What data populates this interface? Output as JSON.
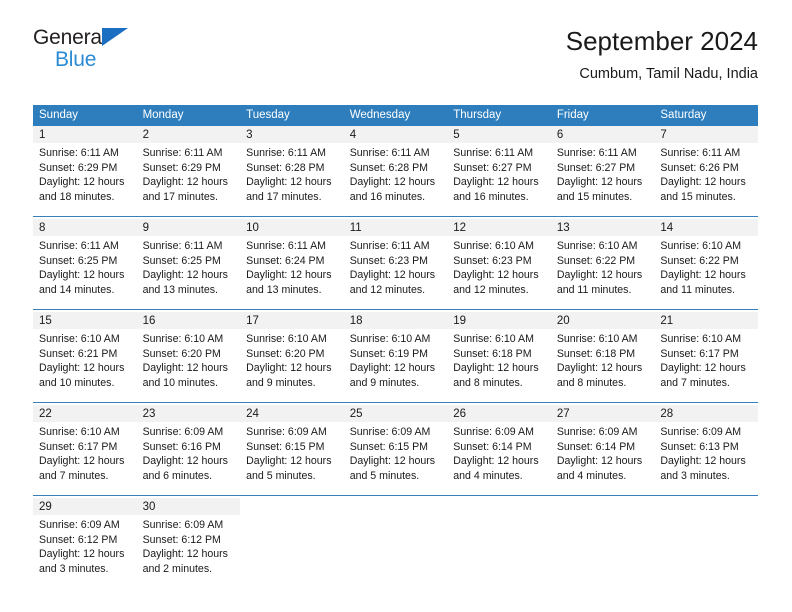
{
  "brand": {
    "line1": "General",
    "line2": "Blue",
    "accent_color": "#2b8bd4",
    "triangle_color": "#1b6ec2"
  },
  "header": {
    "title": "September 2024",
    "subtitle": "Cumbum, Tamil Nadu, India"
  },
  "calendar": {
    "header_bg": "#2e7ebd",
    "daynum_band_bg": "#f2f2f2",
    "week_separator_color": "#3b7fb8",
    "weekday_headers": [
      "Sunday",
      "Monday",
      "Tuesday",
      "Wednesday",
      "Thursday",
      "Friday",
      "Saturday"
    ],
    "weeks": [
      [
        {
          "day": "1",
          "sunrise": "Sunrise: 6:11 AM",
          "sunset": "Sunset: 6:29 PM",
          "daylight_line1": "Daylight: 12 hours",
          "daylight_line2": "and 18 minutes."
        },
        {
          "day": "2",
          "sunrise": "Sunrise: 6:11 AM",
          "sunset": "Sunset: 6:29 PM",
          "daylight_line1": "Daylight: 12 hours",
          "daylight_line2": "and 17 minutes."
        },
        {
          "day": "3",
          "sunrise": "Sunrise: 6:11 AM",
          "sunset": "Sunset: 6:28 PM",
          "daylight_line1": "Daylight: 12 hours",
          "daylight_line2": "and 17 minutes."
        },
        {
          "day": "4",
          "sunrise": "Sunrise: 6:11 AM",
          "sunset": "Sunset: 6:28 PM",
          "daylight_line1": "Daylight: 12 hours",
          "daylight_line2": "and 16 minutes."
        },
        {
          "day": "5",
          "sunrise": "Sunrise: 6:11 AM",
          "sunset": "Sunset: 6:27 PM",
          "daylight_line1": "Daylight: 12 hours",
          "daylight_line2": "and 16 minutes."
        },
        {
          "day": "6",
          "sunrise": "Sunrise: 6:11 AM",
          "sunset": "Sunset: 6:27 PM",
          "daylight_line1": "Daylight: 12 hours",
          "daylight_line2": "and 15 minutes."
        },
        {
          "day": "7",
          "sunrise": "Sunrise: 6:11 AM",
          "sunset": "Sunset: 6:26 PM",
          "daylight_line1": "Daylight: 12 hours",
          "daylight_line2": "and 15 minutes."
        }
      ],
      [
        {
          "day": "8",
          "sunrise": "Sunrise: 6:11 AM",
          "sunset": "Sunset: 6:25 PM",
          "daylight_line1": "Daylight: 12 hours",
          "daylight_line2": "and 14 minutes."
        },
        {
          "day": "9",
          "sunrise": "Sunrise: 6:11 AM",
          "sunset": "Sunset: 6:25 PM",
          "daylight_line1": "Daylight: 12 hours",
          "daylight_line2": "and 13 minutes."
        },
        {
          "day": "10",
          "sunrise": "Sunrise: 6:11 AM",
          "sunset": "Sunset: 6:24 PM",
          "daylight_line1": "Daylight: 12 hours",
          "daylight_line2": "and 13 minutes."
        },
        {
          "day": "11",
          "sunrise": "Sunrise: 6:11 AM",
          "sunset": "Sunset: 6:23 PM",
          "daylight_line1": "Daylight: 12 hours",
          "daylight_line2": "and 12 minutes."
        },
        {
          "day": "12",
          "sunrise": "Sunrise: 6:10 AM",
          "sunset": "Sunset: 6:23 PM",
          "daylight_line1": "Daylight: 12 hours",
          "daylight_line2": "and 12 minutes."
        },
        {
          "day": "13",
          "sunrise": "Sunrise: 6:10 AM",
          "sunset": "Sunset: 6:22 PM",
          "daylight_line1": "Daylight: 12 hours",
          "daylight_line2": "and 11 minutes."
        },
        {
          "day": "14",
          "sunrise": "Sunrise: 6:10 AM",
          "sunset": "Sunset: 6:22 PM",
          "daylight_line1": "Daylight: 12 hours",
          "daylight_line2": "and 11 minutes."
        }
      ],
      [
        {
          "day": "15",
          "sunrise": "Sunrise: 6:10 AM",
          "sunset": "Sunset: 6:21 PM",
          "daylight_line1": "Daylight: 12 hours",
          "daylight_line2": "and 10 minutes."
        },
        {
          "day": "16",
          "sunrise": "Sunrise: 6:10 AM",
          "sunset": "Sunset: 6:20 PM",
          "daylight_line1": "Daylight: 12 hours",
          "daylight_line2": "and 10 minutes."
        },
        {
          "day": "17",
          "sunrise": "Sunrise: 6:10 AM",
          "sunset": "Sunset: 6:20 PM",
          "daylight_line1": "Daylight: 12 hours",
          "daylight_line2": "and 9 minutes."
        },
        {
          "day": "18",
          "sunrise": "Sunrise: 6:10 AM",
          "sunset": "Sunset: 6:19 PM",
          "daylight_line1": "Daylight: 12 hours",
          "daylight_line2": "and 9 minutes."
        },
        {
          "day": "19",
          "sunrise": "Sunrise: 6:10 AM",
          "sunset": "Sunset: 6:18 PM",
          "daylight_line1": "Daylight: 12 hours",
          "daylight_line2": "and 8 minutes."
        },
        {
          "day": "20",
          "sunrise": "Sunrise: 6:10 AM",
          "sunset": "Sunset: 6:18 PM",
          "daylight_line1": "Daylight: 12 hours",
          "daylight_line2": "and 8 minutes."
        },
        {
          "day": "21",
          "sunrise": "Sunrise: 6:10 AM",
          "sunset": "Sunset: 6:17 PM",
          "daylight_line1": "Daylight: 12 hours",
          "daylight_line2": "and 7 minutes."
        }
      ],
      [
        {
          "day": "22",
          "sunrise": "Sunrise: 6:10 AM",
          "sunset": "Sunset: 6:17 PM",
          "daylight_line1": "Daylight: 12 hours",
          "daylight_line2": "and 7 minutes."
        },
        {
          "day": "23",
          "sunrise": "Sunrise: 6:09 AM",
          "sunset": "Sunset: 6:16 PM",
          "daylight_line1": "Daylight: 12 hours",
          "daylight_line2": "and 6 minutes."
        },
        {
          "day": "24",
          "sunrise": "Sunrise: 6:09 AM",
          "sunset": "Sunset: 6:15 PM",
          "daylight_line1": "Daylight: 12 hours",
          "daylight_line2": "and 5 minutes."
        },
        {
          "day": "25",
          "sunrise": "Sunrise: 6:09 AM",
          "sunset": "Sunset: 6:15 PM",
          "daylight_line1": "Daylight: 12 hours",
          "daylight_line2": "and 5 minutes."
        },
        {
          "day": "26",
          "sunrise": "Sunrise: 6:09 AM",
          "sunset": "Sunset: 6:14 PM",
          "daylight_line1": "Daylight: 12 hours",
          "daylight_line2": "and 4 minutes."
        },
        {
          "day": "27",
          "sunrise": "Sunrise: 6:09 AM",
          "sunset": "Sunset: 6:14 PM",
          "daylight_line1": "Daylight: 12 hours",
          "daylight_line2": "and 4 minutes."
        },
        {
          "day": "28",
          "sunrise": "Sunrise: 6:09 AM",
          "sunset": "Sunset: 6:13 PM",
          "daylight_line1": "Daylight: 12 hours",
          "daylight_line2": "and 3 minutes."
        }
      ],
      [
        {
          "day": "29",
          "sunrise": "Sunrise: 6:09 AM",
          "sunset": "Sunset: 6:12 PM",
          "daylight_line1": "Daylight: 12 hours",
          "daylight_line2": "and 3 minutes."
        },
        {
          "day": "30",
          "sunrise": "Sunrise: 6:09 AM",
          "sunset": "Sunset: 6:12 PM",
          "daylight_line1": "Daylight: 12 hours",
          "daylight_line2": "and 2 minutes."
        },
        {
          "day": "",
          "sunrise": "",
          "sunset": "",
          "daylight_line1": "",
          "daylight_line2": ""
        },
        {
          "day": "",
          "sunrise": "",
          "sunset": "",
          "daylight_line1": "",
          "daylight_line2": ""
        },
        {
          "day": "",
          "sunrise": "",
          "sunset": "",
          "daylight_line1": "",
          "daylight_line2": ""
        },
        {
          "day": "",
          "sunrise": "",
          "sunset": "",
          "daylight_line1": "",
          "daylight_line2": ""
        },
        {
          "day": "",
          "sunrise": "",
          "sunset": "",
          "daylight_line1": "",
          "daylight_line2": ""
        }
      ]
    ]
  }
}
